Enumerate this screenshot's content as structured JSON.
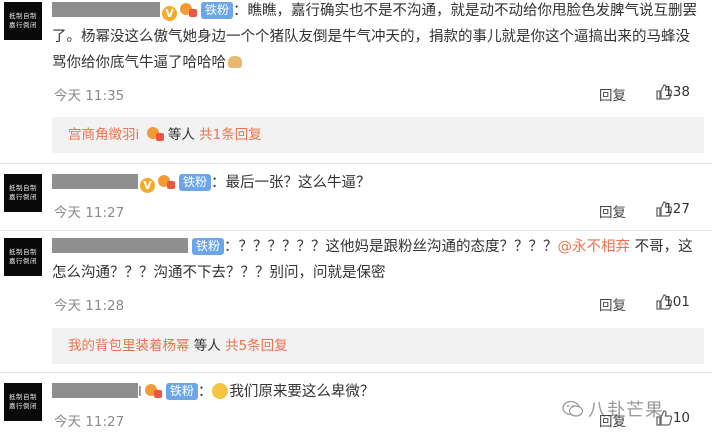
{
  "comments": [
    {
      "avatar_text": [
        "抵制自制",
        "嘉行倒闭"
      ],
      "text": "瞧瞧，嘉行确实也不是不沟通，就是动不动给你甩脸色发脾气说互删罢了。杨幂没这么傲气她身边一个个猪队友倒是牛气冲天的，捐款的事儿就是你这个逼搞出来的马蜂没骂你给你底气牛逼了哈哈哈",
      "fans_badge": "铁粉",
      "time": "今天 11:35",
      "reply_label": "回复",
      "likes": "138",
      "sub": {
        "user": "宫商角徵羽i",
        "suffix": "等人",
        "total": "共1条回复"
      }
    },
    {
      "avatar_text": [
        "抵制自制",
        "嘉行倒闭"
      ],
      "text": "最后一张？这么牛逼？",
      "fans_badge": "铁粉",
      "time": "今天 11:27",
      "reply_label": "回复",
      "likes": "127"
    },
    {
      "avatar_text": [
        "抵制自制",
        "嘉行倒闭"
      ],
      "text_a": "？？？？？？这他妈是跟粉丝沟通的态度？？？？",
      "mention": "@永不相弃",
      "text_b": "不哥，这怎么沟通？？？沟通不下去？？？别问，问就是保密",
      "fans_badge": "铁粉",
      "time": "今天 11:28",
      "reply_label": "回复",
      "likes": "101",
      "sub": {
        "user": "我的背包里装着杨幂",
        "suffix": "等人",
        "total": "共5条回复"
      }
    },
    {
      "avatar_text": [
        "抵制自制",
        "嘉行倒闭"
      ],
      "text": "我们原来要这么卑微？",
      "fans_badge": "铁粉",
      "time": "今天 11:27",
      "reply_label": "回复",
      "likes": "10"
    }
  ],
  "watermark": "八卦芒果",
  "colors": {
    "accent": "#eb7350",
    "fans": "#6ca6e8",
    "sub_bg": "#f2f2f2"
  }
}
